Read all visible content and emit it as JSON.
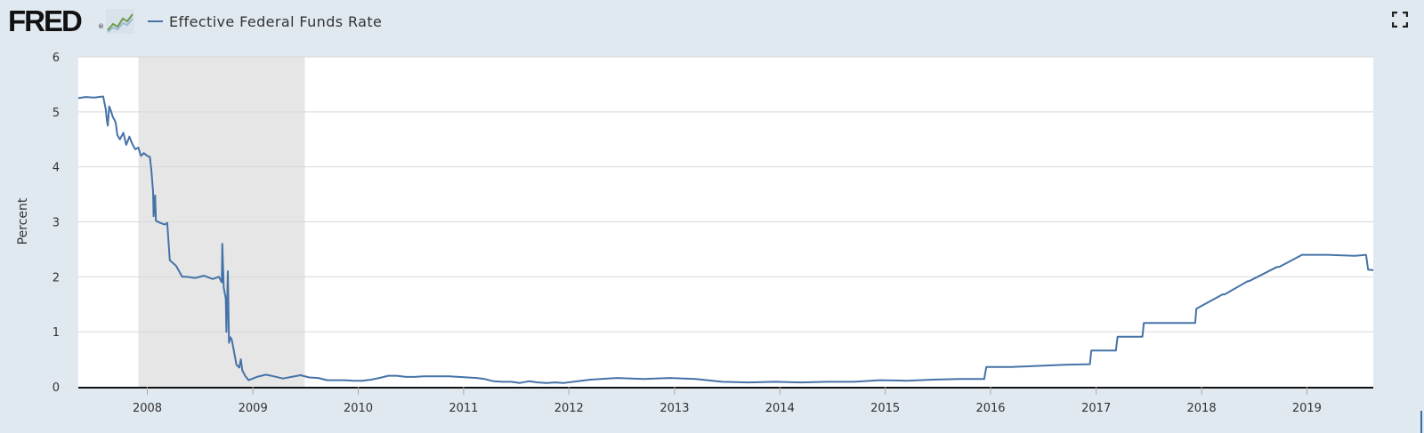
{
  "header": {
    "logo_text": "FRED",
    "logo_reg": "®",
    "legend_label": "Effective Federal Funds Rate"
  },
  "icons": {
    "logo": "fred-logo-graph-icon",
    "fullscreen": "fullscreen-expand-icon"
  },
  "colors": {
    "background": "#e1e9f0",
    "plot_background": "#ffffff",
    "series": "#4572a7",
    "recession_shade": "#e6e6e6",
    "grid": "#d8d8d8"
  },
  "chart_data": {
    "type": "line",
    "title": "",
    "xlabel": "",
    "ylabel": "Percent",
    "ylim": [
      0,
      6
    ],
    "yticks": [
      "0",
      "1",
      "2",
      "3",
      "4",
      "5",
      "6"
    ],
    "xlim": [
      "2007-05-07",
      "2019-08-19"
    ],
    "xticks": [
      "2008",
      "2009",
      "2010",
      "2011",
      "2012",
      "2013",
      "2014",
      "2015",
      "2016",
      "2017",
      "2018",
      "2019"
    ],
    "recessions": [
      {
        "start": "2007-12-01",
        "end": "2009-06-30"
      }
    ],
    "grid": "horizontal",
    "legend": "top-left",
    "series": [
      {
        "name": "Effective Federal Funds Rate",
        "x": [
          "2007-05-07",
          "2007-06-01",
          "2007-07-01",
          "2007-08-01",
          "2007-08-10",
          "2007-08-14",
          "2007-08-17",
          "2007-08-22",
          "2007-08-28",
          "2007-09-04",
          "2007-09-10",
          "2007-09-14",
          "2007-09-19",
          "2007-09-28",
          "2007-10-10",
          "2007-10-20",
          "2007-10-31",
          "2007-11-10",
          "2007-11-20",
          "2007-12-01",
          "2007-12-10",
          "2007-12-20",
          "2008-01-01",
          "2008-01-10",
          "2008-01-15",
          "2008-01-21",
          "2008-01-23",
          "2008-01-28",
          "2008-01-31",
          "2008-02-15",
          "2008-03-01",
          "2008-03-10",
          "2008-03-19",
          "2008-04-10",
          "2008-05-01",
          "2008-05-15",
          "2008-06-15",
          "2008-07-15",
          "2008-08-15",
          "2008-09-05",
          "2008-09-15",
          "2008-09-17",
          "2008-09-22",
          "2008-09-29",
          "2008-10-01",
          "2008-10-06",
          "2008-10-10",
          "2008-10-15",
          "2008-10-20",
          "2008-10-29",
          "2008-11-05",
          "2008-11-15",
          "2008-11-20",
          "2008-11-25",
          "2008-12-05",
          "2008-12-17",
          "2009-01-15",
          "2009-02-15",
          "2009-03-15",
          "2009-04-15",
          "2009-05-15",
          "2009-06-15",
          "2009-07-15",
          "2009-08-15",
          "2009-09-15",
          "2009-10-15",
          "2009-11-15",
          "2009-12-15",
          "2010-01-15",
          "2010-02-15",
          "2010-03-15",
          "2010-04-15",
          "2010-05-15",
          "2010-06-15",
          "2010-07-15",
          "2010-08-15",
          "2010-09-15",
          "2010-10-15",
          "2010-11-15",
          "2010-12-15",
          "2011-01-15",
          "2011-02-15",
          "2011-03-15",
          "2011-04-15",
          "2011-05-15",
          "2011-06-15",
          "2011-07-15",
          "2011-08-15",
          "2011-09-15",
          "2011-10-15",
          "2011-11-15",
          "2011-12-15",
          "2012-03-15",
          "2012-06-15",
          "2012-09-15",
          "2012-12-15",
          "2013-03-15",
          "2013-06-15",
          "2013-09-15",
          "2013-12-15",
          "2014-03-15",
          "2014-06-15",
          "2014-09-15",
          "2014-12-15",
          "2015-03-15",
          "2015-06-15",
          "2015-09-15",
          "2015-12-10",
          "2015-12-17",
          "2016-03-15",
          "2016-06-15",
          "2016-09-15",
          "2016-12-10",
          "2016-12-15",
          "2017-03-10",
          "2017-03-16",
          "2017-06-10",
          "2017-06-15",
          "2017-09-15",
          "2017-12-10",
          "2017-12-14",
          "2018-03-15",
          "2018-03-22",
          "2018-06-10",
          "2018-06-14",
          "2018-09-20",
          "2018-09-27",
          "2018-12-15",
          "2018-12-20",
          "2019-03-15",
          "2019-06-15",
          "2019-07-25",
          "2019-08-01",
          "2019-08-19"
        ],
        "values": [
          5.25,
          5.27,
          5.26,
          5.28,
          5.05,
          4.85,
          4.75,
          5.1,
          5.02,
          4.9,
          4.85,
          4.78,
          4.58,
          4.5,
          4.62,
          4.4,
          4.55,
          4.42,
          4.32,
          4.35,
          4.2,
          4.25,
          4.2,
          4.18,
          3.95,
          3.55,
          3.1,
          3.48,
          3.02,
          2.98,
          2.95,
          2.98,
          2.3,
          2.2,
          2.0,
          2.0,
          1.98,
          2.02,
          1.96,
          2.0,
          1.9,
          2.6,
          1.8,
          1.6,
          1.0,
          2.1,
          0.8,
          0.9,
          0.85,
          0.6,
          0.4,
          0.35,
          0.5,
          0.3,
          0.2,
          0.12,
          0.18,
          0.22,
          0.19,
          0.15,
          0.18,
          0.21,
          0.17,
          0.16,
          0.12,
          0.12,
          0.12,
          0.11,
          0.11,
          0.13,
          0.16,
          0.2,
          0.2,
          0.18,
          0.18,
          0.19,
          0.19,
          0.19,
          0.19,
          0.18,
          0.17,
          0.16,
          0.14,
          0.1,
          0.09,
          0.09,
          0.07,
          0.1,
          0.08,
          0.07,
          0.08,
          0.07,
          0.13,
          0.16,
          0.14,
          0.16,
          0.14,
          0.09,
          0.08,
          0.09,
          0.08,
          0.09,
          0.09,
          0.12,
          0.11,
          0.13,
          0.14,
          0.14,
          0.36,
          0.36,
          0.38,
          0.4,
          0.41,
          0.66,
          0.66,
          0.91,
          0.91,
          1.16,
          1.16,
          1.16,
          1.42,
          1.68,
          1.68,
          1.92,
          1.92,
          2.18,
          2.18,
          2.4,
          2.4,
          2.4,
          2.38,
          2.4,
          2.13,
          2.12
        ]
      }
    ]
  }
}
